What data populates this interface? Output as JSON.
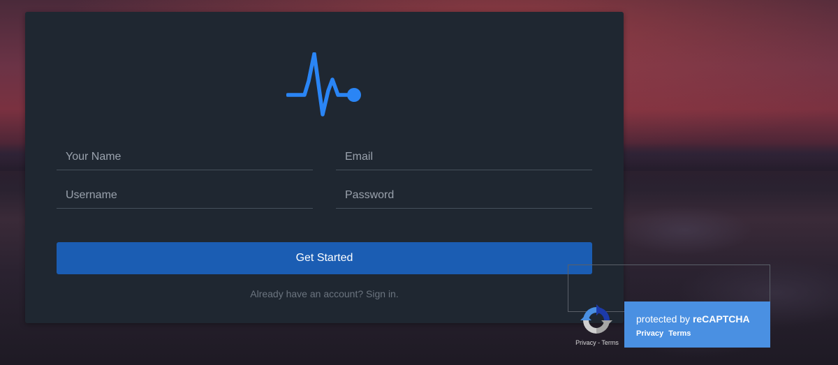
{
  "form": {
    "name_placeholder": "Your Name",
    "email_placeholder": "Email",
    "username_placeholder": "Username",
    "password_placeholder": "Password",
    "submit_label": "Get Started",
    "signin_text": "Already have an account? Sign in."
  },
  "recaptcha": {
    "title_prefix": "protected by ",
    "title_brand": "reCAPTCHA",
    "privacy_label": "Privacy",
    "terms_label": "Terms",
    "small_links": "Privacy - Terms"
  },
  "icons": {
    "logo": "heartbeat-pulse-icon",
    "recaptcha": "recaptcha-icon"
  },
  "colors": {
    "card_bg": "#1f2731",
    "accent": "#2a85f5",
    "button_bg": "#1b5db3",
    "recaptcha_bg": "#4a90e2"
  }
}
